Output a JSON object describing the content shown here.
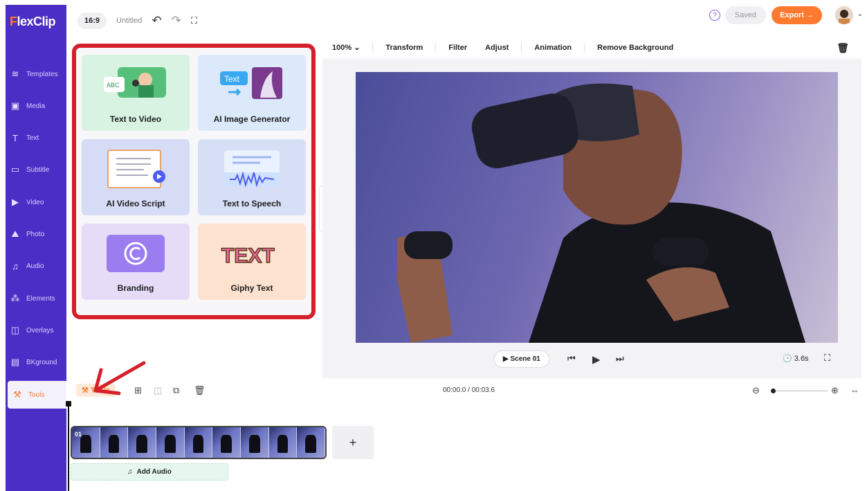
{
  "app": {
    "logo_f": "F",
    "logo_rest": "lexClip",
    "brand_color": "#4a2ec5",
    "accent_color": "#ff7a2e"
  },
  "topbar": {
    "ratio": "16:9",
    "title": "Untitled",
    "undo_icon": "undo-icon",
    "redo_icon": "redo-icon",
    "fullscreen_icon": "fullscreen-icon",
    "help": "?",
    "saved": "Saved",
    "export": "Export →"
  },
  "sidebar": {
    "items": [
      {
        "label": "Templates",
        "icon": "≋"
      },
      {
        "label": "Media",
        "icon": "▣"
      },
      {
        "label": "Text",
        "icon": "T"
      },
      {
        "label": "Subtitle",
        "icon": "▭"
      },
      {
        "label": "Video",
        "icon": "▶"
      },
      {
        "label": "Photo",
        "icon": "⛰"
      },
      {
        "label": "Audio",
        "icon": "♫"
      },
      {
        "label": "Elements",
        "icon": "⁂"
      },
      {
        "label": "Overlays",
        "icon": "◫"
      },
      {
        "label": "BKground",
        "icon": "▤"
      },
      {
        "label": "Tools",
        "icon": "⚒"
      }
    ],
    "active": "Tools"
  },
  "tools_panel": {
    "cards": [
      {
        "label": "Text to Video",
        "bg": "#d8f3e2"
      },
      {
        "label": "AI Image Generator",
        "bg": "#dbe9fb"
      },
      {
        "label": "AI Video Script",
        "bg": "#d6dbf6"
      },
      {
        "label": "Text to Speech",
        "bg": "#d6dff6"
      },
      {
        "label": "Branding",
        "bg": "#e6dcf8"
      },
      {
        "label": "Giphy Text",
        "bg": "#fde2cf"
      }
    ],
    "art_text": "Text",
    "art_abc": "ABC",
    "art_giphy": "TEXT",
    "border_color": "#d61f2b"
  },
  "editor_toolbar": {
    "zoom": "100% ⌄",
    "items": [
      "Transform",
      "Filter",
      "Adjust",
      "Animation",
      "Remove Background"
    ],
    "delete_icon": "trash-icon"
  },
  "playback": {
    "scene": "▶ Scene 01",
    "prev": "⏮",
    "play": "▶",
    "next": "⏭",
    "duration": "3.6s"
  },
  "timeline": {
    "tools_label": "Tools",
    "timecode": "00:00.0 / 00:03.6",
    "scene_number": "01",
    "add_scene": "+",
    "add_audio": "Add Audio",
    "zoom_out": "⊖",
    "zoom_in": "⊕"
  }
}
